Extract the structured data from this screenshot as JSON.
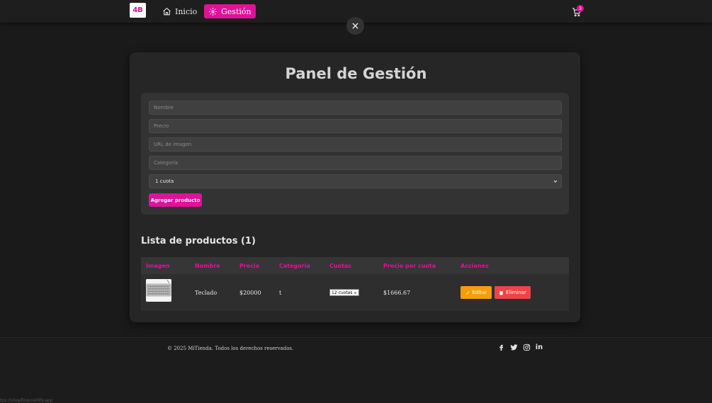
{
  "nav": {
    "logo_text": "4B",
    "home_label": "Inicio",
    "gestion_label": "Gestión",
    "cart_count": "3"
  },
  "close_label": "×",
  "panel": {
    "title": "Panel de Gestión"
  },
  "form": {
    "name_placeholder": "Nombre",
    "price_placeholder": "Precio",
    "image_placeholder": "URL de imagen",
    "category_placeholder": "Categoría",
    "cuotas_selected": "1 cuota",
    "add_button": "Agregar producto"
  },
  "list": {
    "title": "Lista de productos (1)",
    "headers": [
      "Imagen",
      "Nombre",
      "Precio",
      "Categoría",
      "Cuotas",
      "Precio por cuota",
      "Acciones"
    ],
    "rows": [
      {
        "name": "Teclado",
        "price": "$20000",
        "category": "t",
        "cuotas": "12 cuotas",
        "price_per_cuota": "$1666.67",
        "edit_label": "Editar",
        "delete_label": "Eliminar"
      }
    ]
  },
  "footer": {
    "copyright": "© 2025 MiTienda. Todos los derechos reservados.",
    "linkedin_text": "in"
  },
  "status_bar_url": "tps://shopflow.netlify.app",
  "colors": {
    "accent": "#e0119a",
    "edit": "#f59e0b",
    "delete": "#ef4444"
  },
  "icons": [
    "home-icon",
    "gear-icon",
    "cart-icon",
    "close-icon",
    "chevron-down-icon",
    "pencil-icon",
    "trash-icon",
    "facebook-icon",
    "twitter-icon",
    "instagram-icon",
    "linkedin-icon"
  ]
}
